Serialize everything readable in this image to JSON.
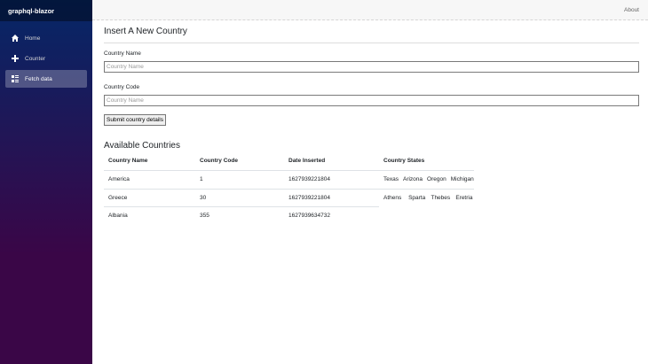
{
  "sidebar": {
    "brand": "graphql-blazor",
    "items": [
      {
        "label": "Home",
        "icon": "home-icon"
      },
      {
        "label": "Counter",
        "icon": "plus-icon"
      },
      {
        "label": "Fetch data",
        "icon": "list-icon",
        "active": true
      }
    ]
  },
  "topbar": {
    "about_label": "About"
  },
  "form": {
    "title": "Insert A New Country",
    "name_label": "Country Name",
    "name_placeholder": "Country Name",
    "code_label": "Country Code",
    "code_placeholder": "Country Name",
    "submit_label": "Submit country details"
  },
  "countries": {
    "title": "Available Countries",
    "headers": [
      "Country Name",
      "Country Code",
      "Date Inserted",
      "Country States"
    ],
    "rows": [
      {
        "name": "America",
        "code": "1",
        "date": "1627939221804",
        "states": [
          "Texas",
          "Arizona",
          "Oregon",
          "Michigan"
        ]
      },
      {
        "name": "Greece",
        "code": "30",
        "date": "1627939221804",
        "states": [
          "Athens",
          "Sparta",
          "Thebes",
          "Eretria"
        ]
      },
      {
        "name": "Albania",
        "code": "355",
        "date": "1627939634732",
        "states": []
      }
    ]
  }
}
